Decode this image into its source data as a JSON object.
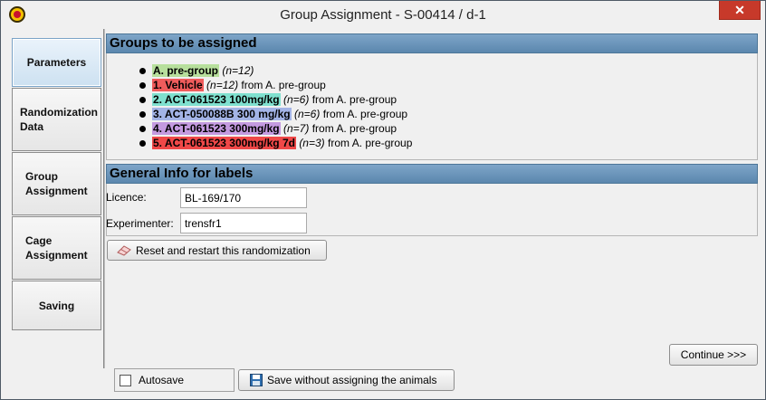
{
  "window": {
    "title": "Group Assignment - S-00414 / d-1",
    "close_glyph": "✕"
  },
  "tabs": [
    {
      "label": "Parameters",
      "active": true
    },
    {
      "label": "Randomization Data"
    },
    {
      "label": "Group Assignment"
    },
    {
      "label": "Cage Assignment"
    },
    {
      "label": "Saving"
    }
  ],
  "groups_section": {
    "header": "Groups to be assigned",
    "groups": [
      {
        "name": "A. pre-group",
        "count": "(n=12)",
        "from": "",
        "color": "#b7df9c"
      },
      {
        "name": "1. Vehicle",
        "count": "(n=12)",
        "from": "from A. pre-group",
        "color": "#f05c5c"
      },
      {
        "name": "2. ACT-061523 100mg/kg",
        "count": "(n=6)",
        "from": "from A. pre-group",
        "color": "#7fe0cf"
      },
      {
        "name": "3. ACT-050088B 300 mg/kg",
        "count": "(n=6)",
        "from": "from A. pre-group",
        "color": "#a3b4e6"
      },
      {
        "name": "4. ACT-061523 300mg/kg",
        "count": "(n=7)",
        "from": "from A. pre-group",
        "color": "#c49ae0"
      },
      {
        "name": "5. ACT-061523 300mg/kg 7d",
        "count": "(n=3)",
        "from": "from A. pre-group",
        "color": "#f04848"
      }
    ]
  },
  "info_section": {
    "header": "General Info for labels",
    "licence_label": "Licence:",
    "licence_value": "BL-169/170",
    "experimenter_label": "Experimenter:",
    "experimenter_value": "trensfr1"
  },
  "buttons": {
    "reset": "Reset and restart this randomization",
    "continue": "Continue >>>",
    "save_without": "Save without assigning the animals"
  },
  "autosave": {
    "label": "Autosave",
    "checked": false
  },
  "icons": {
    "reset": "eraser-icon",
    "save": "floppy-disk-icon",
    "app": "app-logo-icon"
  }
}
